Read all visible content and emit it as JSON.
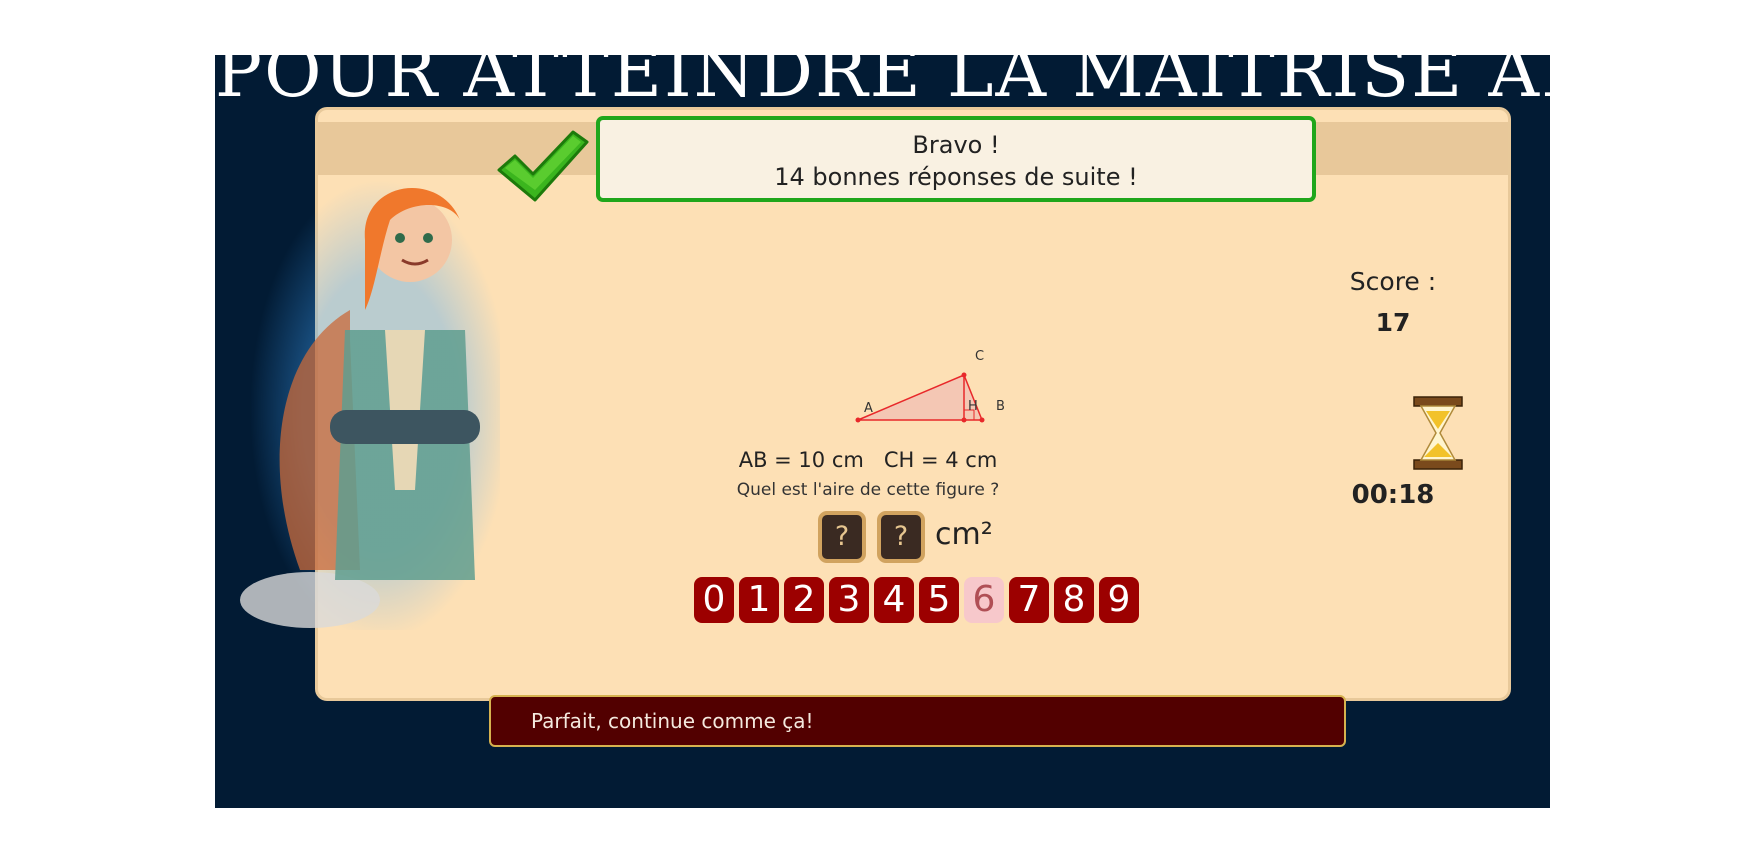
{
  "banner": {
    "text": "POUR ATTEINDRE LA MAÎTRISE ABSOLUE"
  },
  "message": {
    "line1": "Bravo !",
    "line2": "14 bonnes réponses de suite !"
  },
  "score": {
    "label": "Score :",
    "value": "17"
  },
  "timer": {
    "value": "00:18"
  },
  "figure": {
    "points": [
      "A",
      "B",
      "C",
      "H"
    ],
    "colors": {
      "stroke": "#e8282a",
      "fill": "#f4c7b4"
    }
  },
  "question": {
    "measures": "AB = 10 cm   CH = 4 cm",
    "text": "Quel est l'aire de cette figure ?",
    "answer_slots": [
      "?",
      "?"
    ],
    "unit": "cm²"
  },
  "keypad": {
    "digits": [
      "0",
      "1",
      "2",
      "3",
      "4",
      "5",
      "6",
      "7",
      "8",
      "9"
    ],
    "selected": "6"
  },
  "feedback": {
    "text": "Parfait, continue comme ça!"
  },
  "colors": {
    "background": "#021b34",
    "panel": "#fde0b5",
    "success": "#20a61b",
    "digit": "#9c0000",
    "feedback": "#520000"
  },
  "icons": [
    "check-icon",
    "hourglass-icon",
    "character-avatar"
  ]
}
